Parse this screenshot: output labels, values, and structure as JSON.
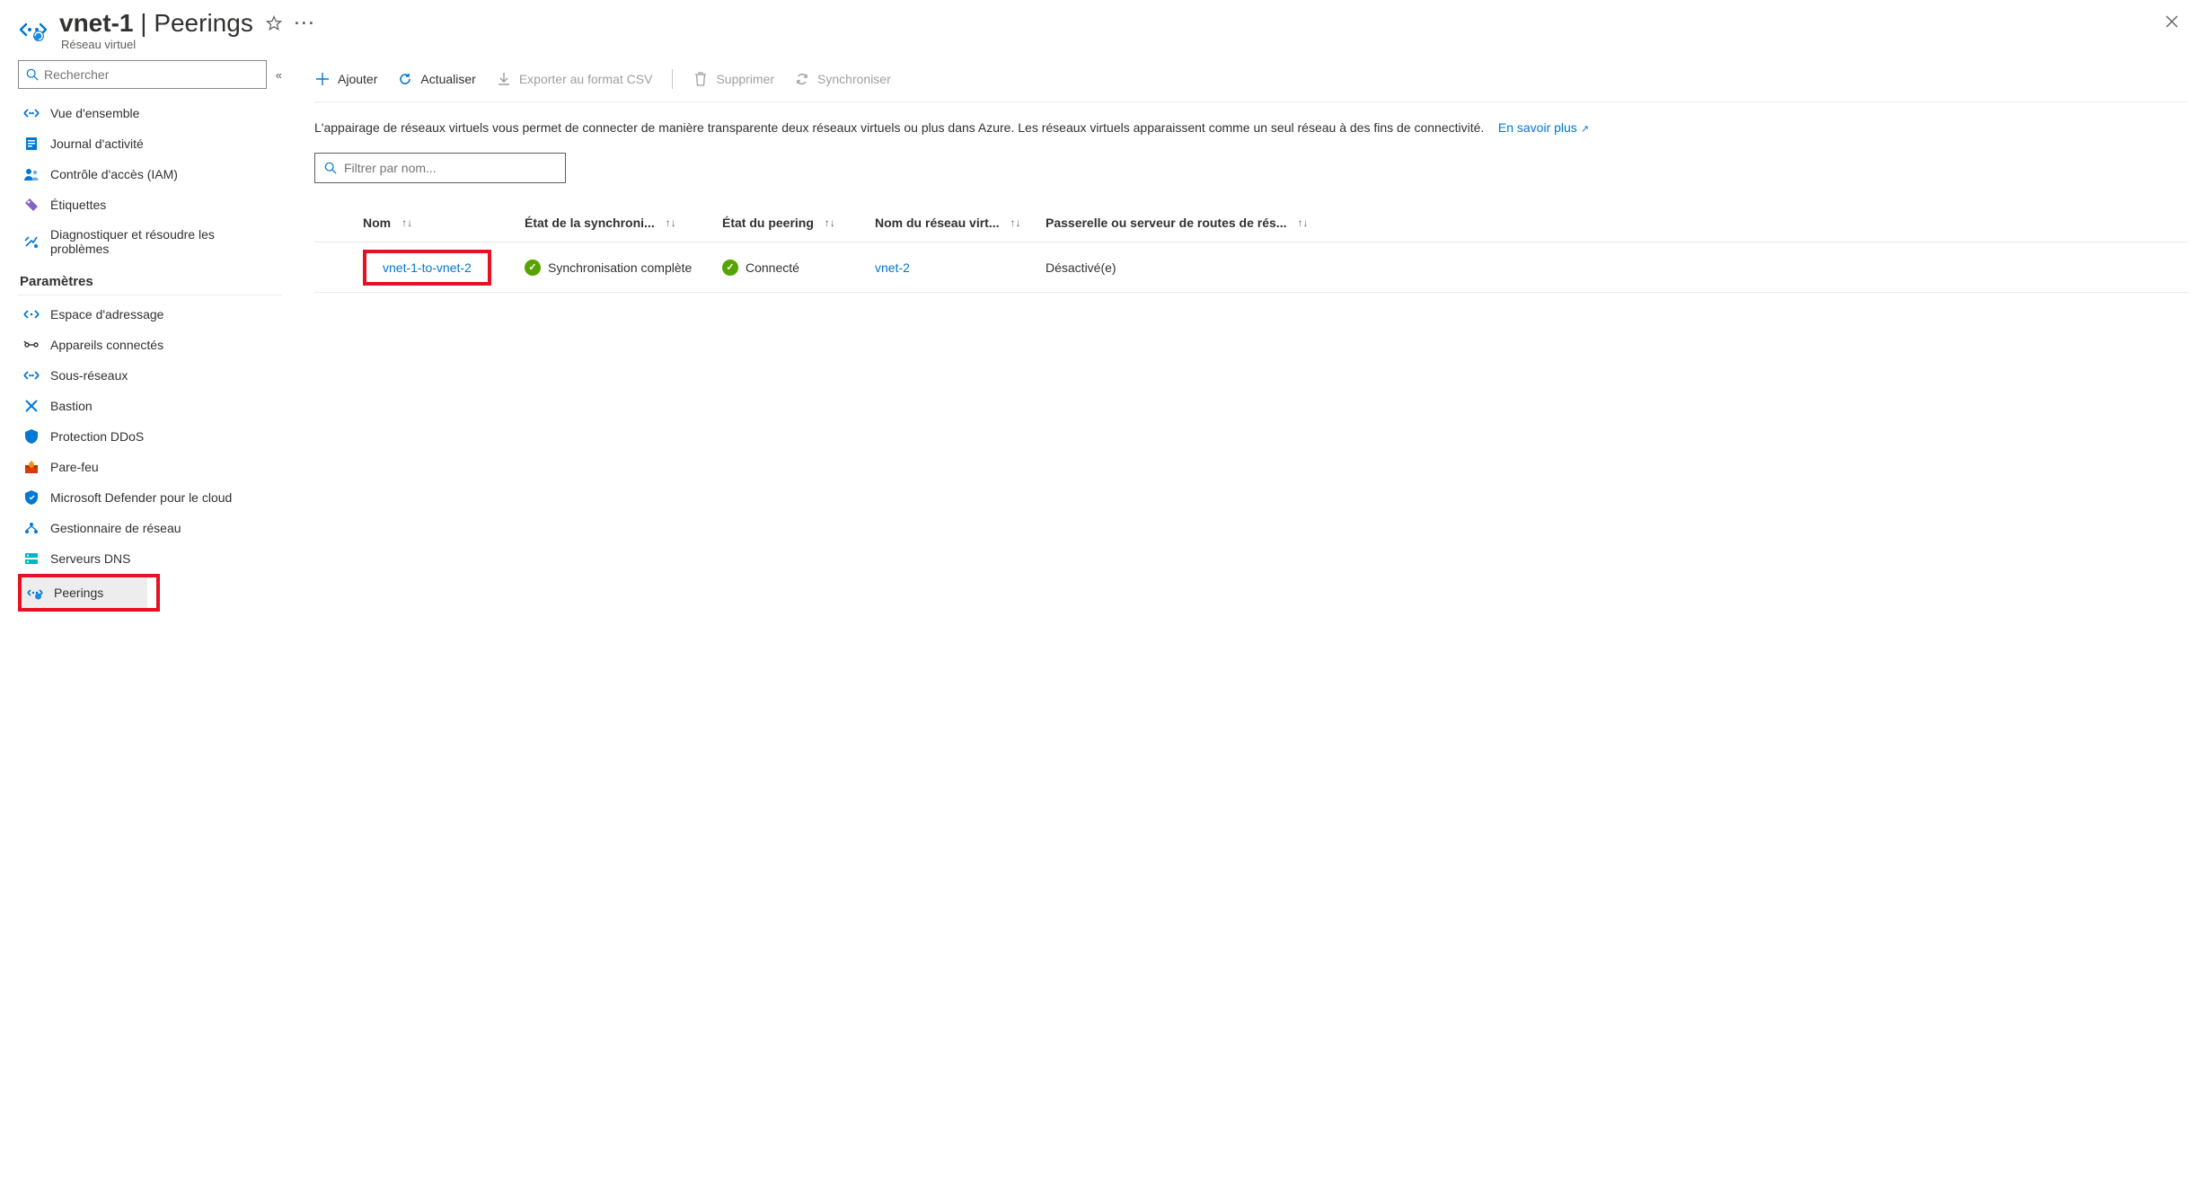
{
  "header": {
    "resource_name": "vnet-1",
    "section": "Peerings",
    "subtitle": "Réseau virtuel"
  },
  "sidebar": {
    "search_placeholder": "Rechercher",
    "items_top": [
      {
        "label": "Vue d'ensemble",
        "icon": "overview"
      },
      {
        "label": "Journal d'activité",
        "icon": "activity-log"
      },
      {
        "label": "Contrôle d'accès (IAM)",
        "icon": "iam"
      },
      {
        "label": "Étiquettes",
        "icon": "tag"
      },
      {
        "label": "Diagnostiquer et résoudre les problèmes",
        "icon": "diagnose"
      }
    ],
    "section_label": "Paramètres",
    "items_settings": [
      {
        "label": "Espace d'adressage",
        "icon": "address-space"
      },
      {
        "label": "Appareils connectés",
        "icon": "devices"
      },
      {
        "label": "Sous-réseaux",
        "icon": "subnets"
      },
      {
        "label": "Bastion",
        "icon": "bastion"
      },
      {
        "label": "Protection DDoS",
        "icon": "ddos"
      },
      {
        "label": "Pare-feu",
        "icon": "firewall"
      },
      {
        "label": "Microsoft Defender pour le cloud",
        "icon": "defender"
      },
      {
        "label": "Gestionnaire de réseau",
        "icon": "network-manager"
      },
      {
        "label": "Serveurs DNS",
        "icon": "dns"
      },
      {
        "label": "Peerings",
        "icon": "peerings",
        "selected": true
      }
    ]
  },
  "toolbar": {
    "add": "Ajouter",
    "refresh": "Actualiser",
    "export_csv": "Exporter au format CSV",
    "delete": "Supprimer",
    "sync": "Synchroniser"
  },
  "description": {
    "text": "L'appairage de réseaux virtuels vous permet de connecter de manière transparente deux réseaux virtuels ou plus dans Azure. Les réseaux virtuels apparaissent comme un seul réseau à des fins de connectivité.",
    "learn_more": "En savoir plus"
  },
  "filter_placeholder": "Filtrer par nom...",
  "table": {
    "columns": {
      "name": "Nom",
      "sync_state": "État de la synchroni...",
      "peer_state": "État du peering",
      "remote_vnet": "Nom du réseau virt...",
      "gateway": "Passerelle ou serveur de routes de rés..."
    },
    "rows": [
      {
        "name": "vnet-1-to-vnet-2",
        "sync_state": "Synchronisation complète",
        "peer_state": "Connecté",
        "remote_vnet": "vnet-2",
        "gateway": "Désactivé(e)"
      }
    ]
  }
}
